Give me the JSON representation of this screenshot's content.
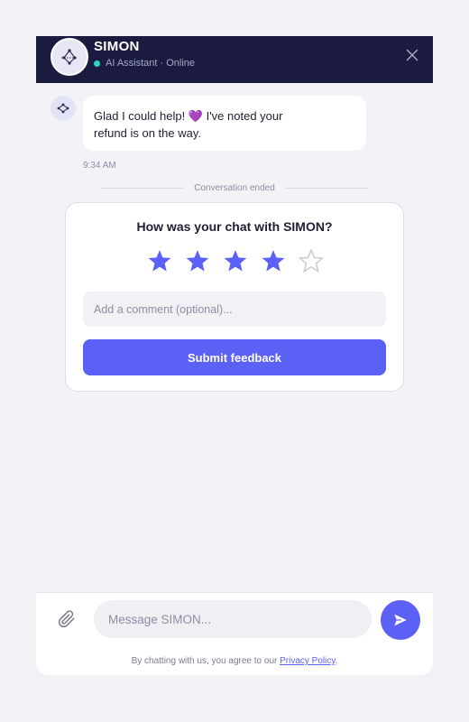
{
  "header": {
    "name": "SIMON",
    "status": "AI Assistant · Online",
    "avatar_icon": "network-icon",
    "close_icon": "close-icon"
  },
  "chat": {
    "messages": [
      {
        "sender": "bot",
        "text": "Glad I could help! 💜 I've noted your refund is on the way.",
        "time": "9:34 AM"
      }
    ],
    "divider_text": "Conversation ended"
  },
  "feedback": {
    "title": "How was your chat with SIMON?",
    "rating": 4,
    "max_rating": 5,
    "comment_placeholder": "Add a comment (optional)...",
    "comment_value": "",
    "submit_label": "Submit feedback"
  },
  "composer": {
    "placeholder": "Message SIMON...",
    "value": "",
    "attach_icon": "paperclip-icon",
    "send_icon": "send-icon"
  },
  "legal": {
    "prefix": "By chatting with us, you agree to our ",
    "link_label": "Privacy Policy",
    "suffix": "."
  },
  "colors": {
    "header_bg": "#1a1b3f",
    "accent": "#5c61f5",
    "online": "#2bd6c4",
    "star_filled": "#5c61f5",
    "star_empty": "#c9cad6"
  }
}
